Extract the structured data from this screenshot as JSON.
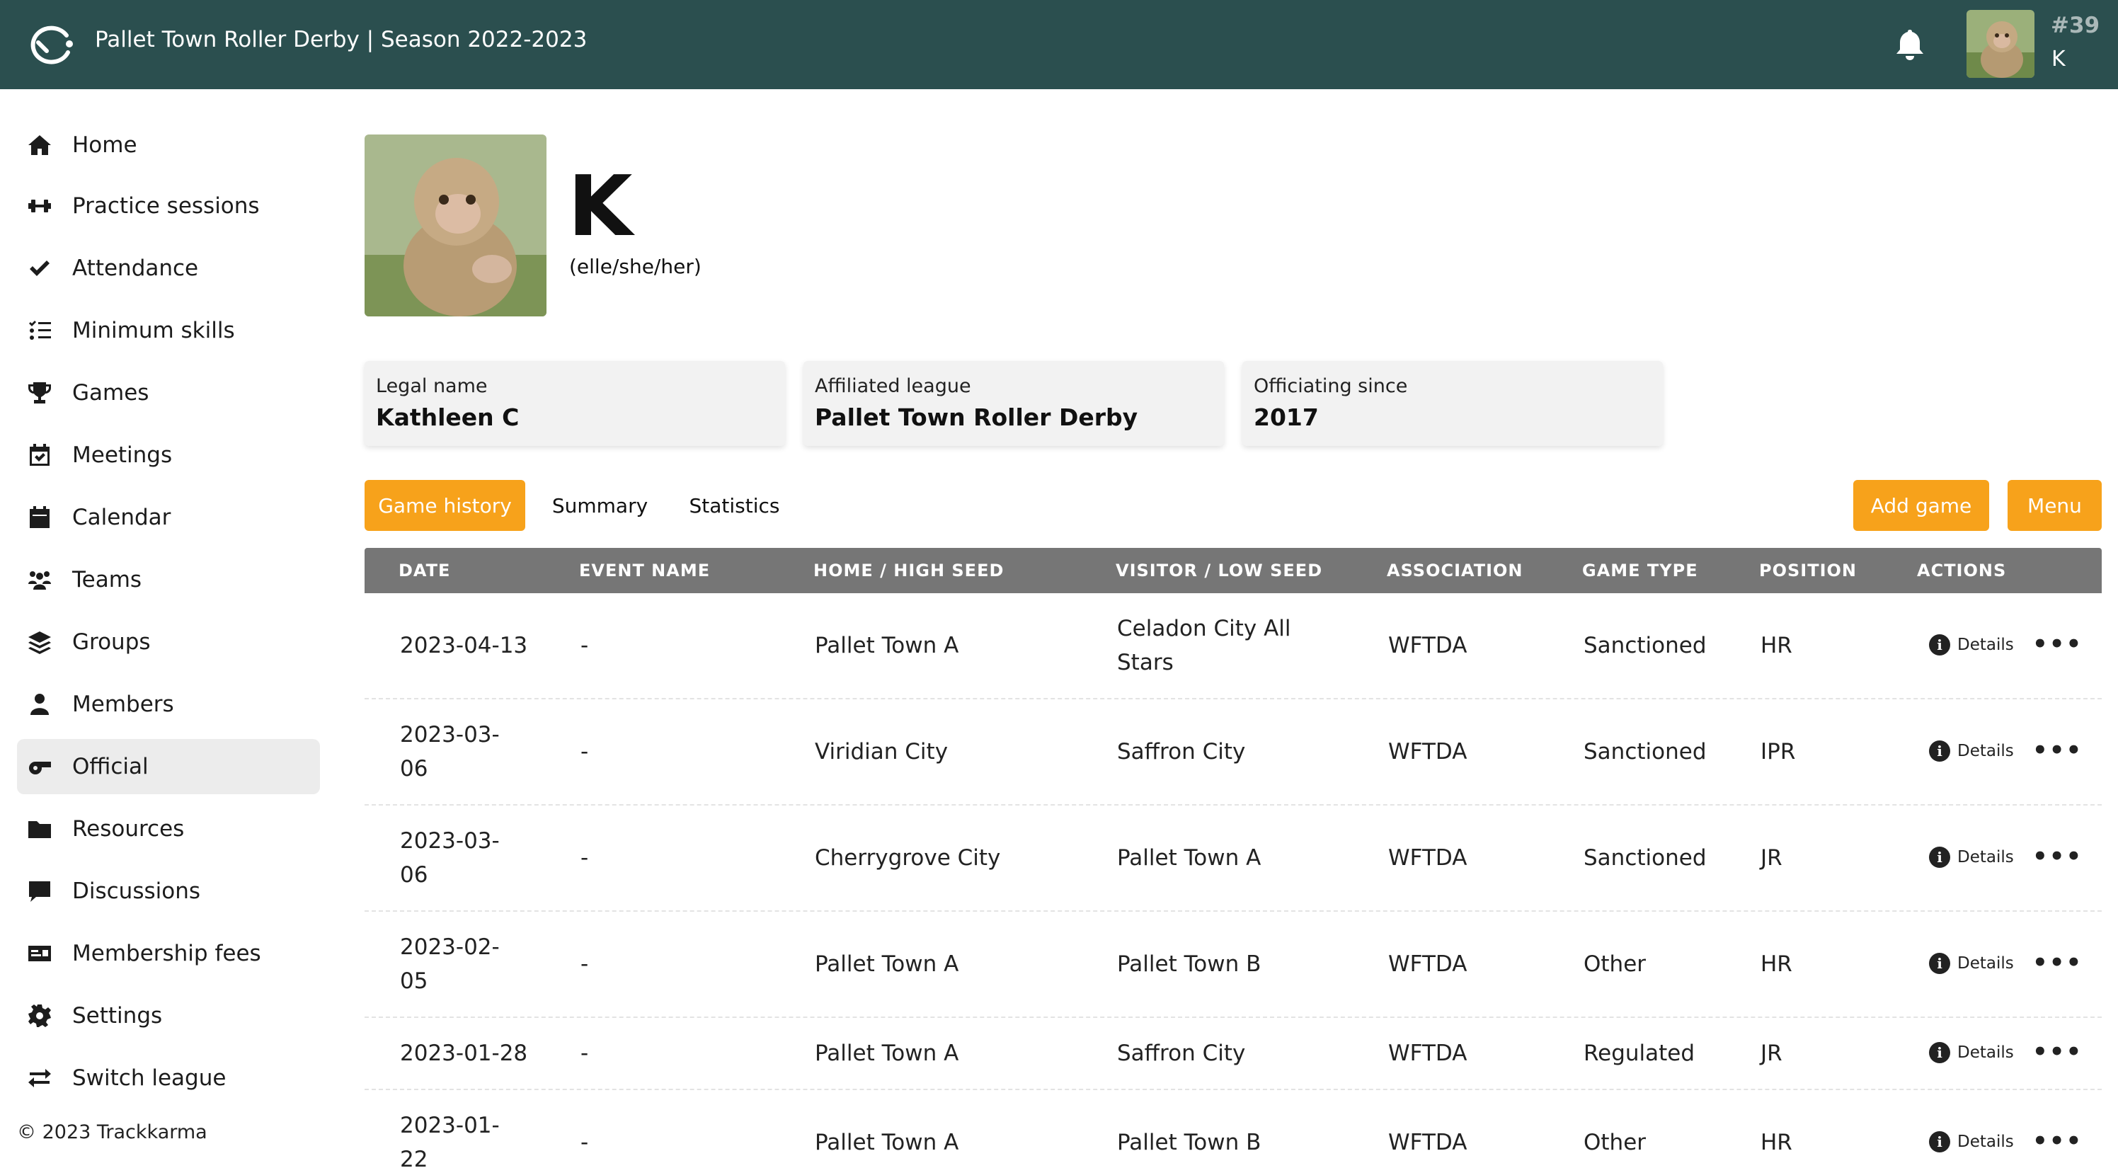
{
  "header": {
    "title": "Pallet Town Roller Derby | Season 2022-2023",
    "user_number": "#39",
    "user_initial": "K"
  },
  "sidebar": {
    "items": [
      {
        "label": "Home",
        "icon": "home-icon"
      },
      {
        "label": "Practice sessions",
        "icon": "dumbbell-icon"
      },
      {
        "label": "Attendance",
        "icon": "check-icon"
      },
      {
        "label": "Minimum skills",
        "icon": "list-check-icon"
      },
      {
        "label": "Games",
        "icon": "trophy-icon"
      },
      {
        "label": "Meetings",
        "icon": "calendar-check-icon"
      },
      {
        "label": "Calendar",
        "icon": "calendar-icon"
      },
      {
        "label": "Teams",
        "icon": "users-icon"
      },
      {
        "label": "Groups",
        "icon": "layers-icon"
      },
      {
        "label": "Members",
        "icon": "user-icon"
      },
      {
        "label": "Official",
        "icon": "whistle-icon",
        "active": true
      },
      {
        "label": "Resources",
        "icon": "folder-icon"
      },
      {
        "label": "Discussions",
        "icon": "comment-icon"
      },
      {
        "label": "Membership fees",
        "icon": "id-card-icon"
      },
      {
        "label": "Settings",
        "icon": "gear-icon"
      },
      {
        "label": "Switch league",
        "icon": "swap-icon"
      }
    ],
    "copyright": "© 2023 Trackkarma"
  },
  "profile": {
    "name": "K",
    "pronouns": "(elle/she/her)"
  },
  "cards": [
    {
      "label": "Legal name",
      "value": "Kathleen C"
    },
    {
      "label": "Affiliated league",
      "value": "Pallet Town Roller Derby"
    },
    {
      "label": "Officiating since",
      "value": "2017"
    }
  ],
  "tabs": {
    "game_history": "Game history",
    "summary": "Summary",
    "statistics": "Statistics"
  },
  "buttons": {
    "add_game": "Add game",
    "menu": "Menu"
  },
  "table": {
    "headers": [
      "DATE",
      "EVENT NAME",
      "HOME / HIGH SEED",
      "VISITOR / LOW SEED",
      "ASSOCIATION",
      "GAME TYPE",
      "POSITION",
      "ACTIONS"
    ],
    "details_label": "Details",
    "more_label": "•••",
    "rows": [
      {
        "date": "2023-04-13",
        "event": "-",
        "home": "Pallet Town A",
        "visitor": "Celadon City All Stars",
        "association": "WFTDA",
        "type": "Sanctioned",
        "position": "HR"
      },
      {
        "date": "2023-03-06",
        "event": "-",
        "home": "Viridian City",
        "visitor": "Saffron City",
        "association": "WFTDA",
        "type": "Sanctioned",
        "position": "IPR"
      },
      {
        "date": "2023-03-06",
        "event": "-",
        "home": "Cherrygrove City",
        "visitor": "Pallet Town A",
        "association": "WFTDA",
        "type": "Sanctioned",
        "position": "JR"
      },
      {
        "date": "2023-02-05",
        "event": "-",
        "home": "Pallet Town A",
        "visitor": "Pallet Town B",
        "association": "WFTDA",
        "type": "Other",
        "position": "HR"
      },
      {
        "date": "2023-01-28",
        "event": "-",
        "home": "Pallet Town A",
        "visitor": "Saffron City",
        "association": "WFTDA",
        "type": "Regulated",
        "position": "JR"
      },
      {
        "date": "2023-01-22",
        "event": "-",
        "home": "Pallet Town A",
        "visitor": "Pallet Town B",
        "association": "WFTDA",
        "type": "Other",
        "position": "HR"
      }
    ]
  },
  "colors": {
    "topbar": "#2b4f4f",
    "accent": "#f7a21b",
    "table_header": "#767676"
  }
}
